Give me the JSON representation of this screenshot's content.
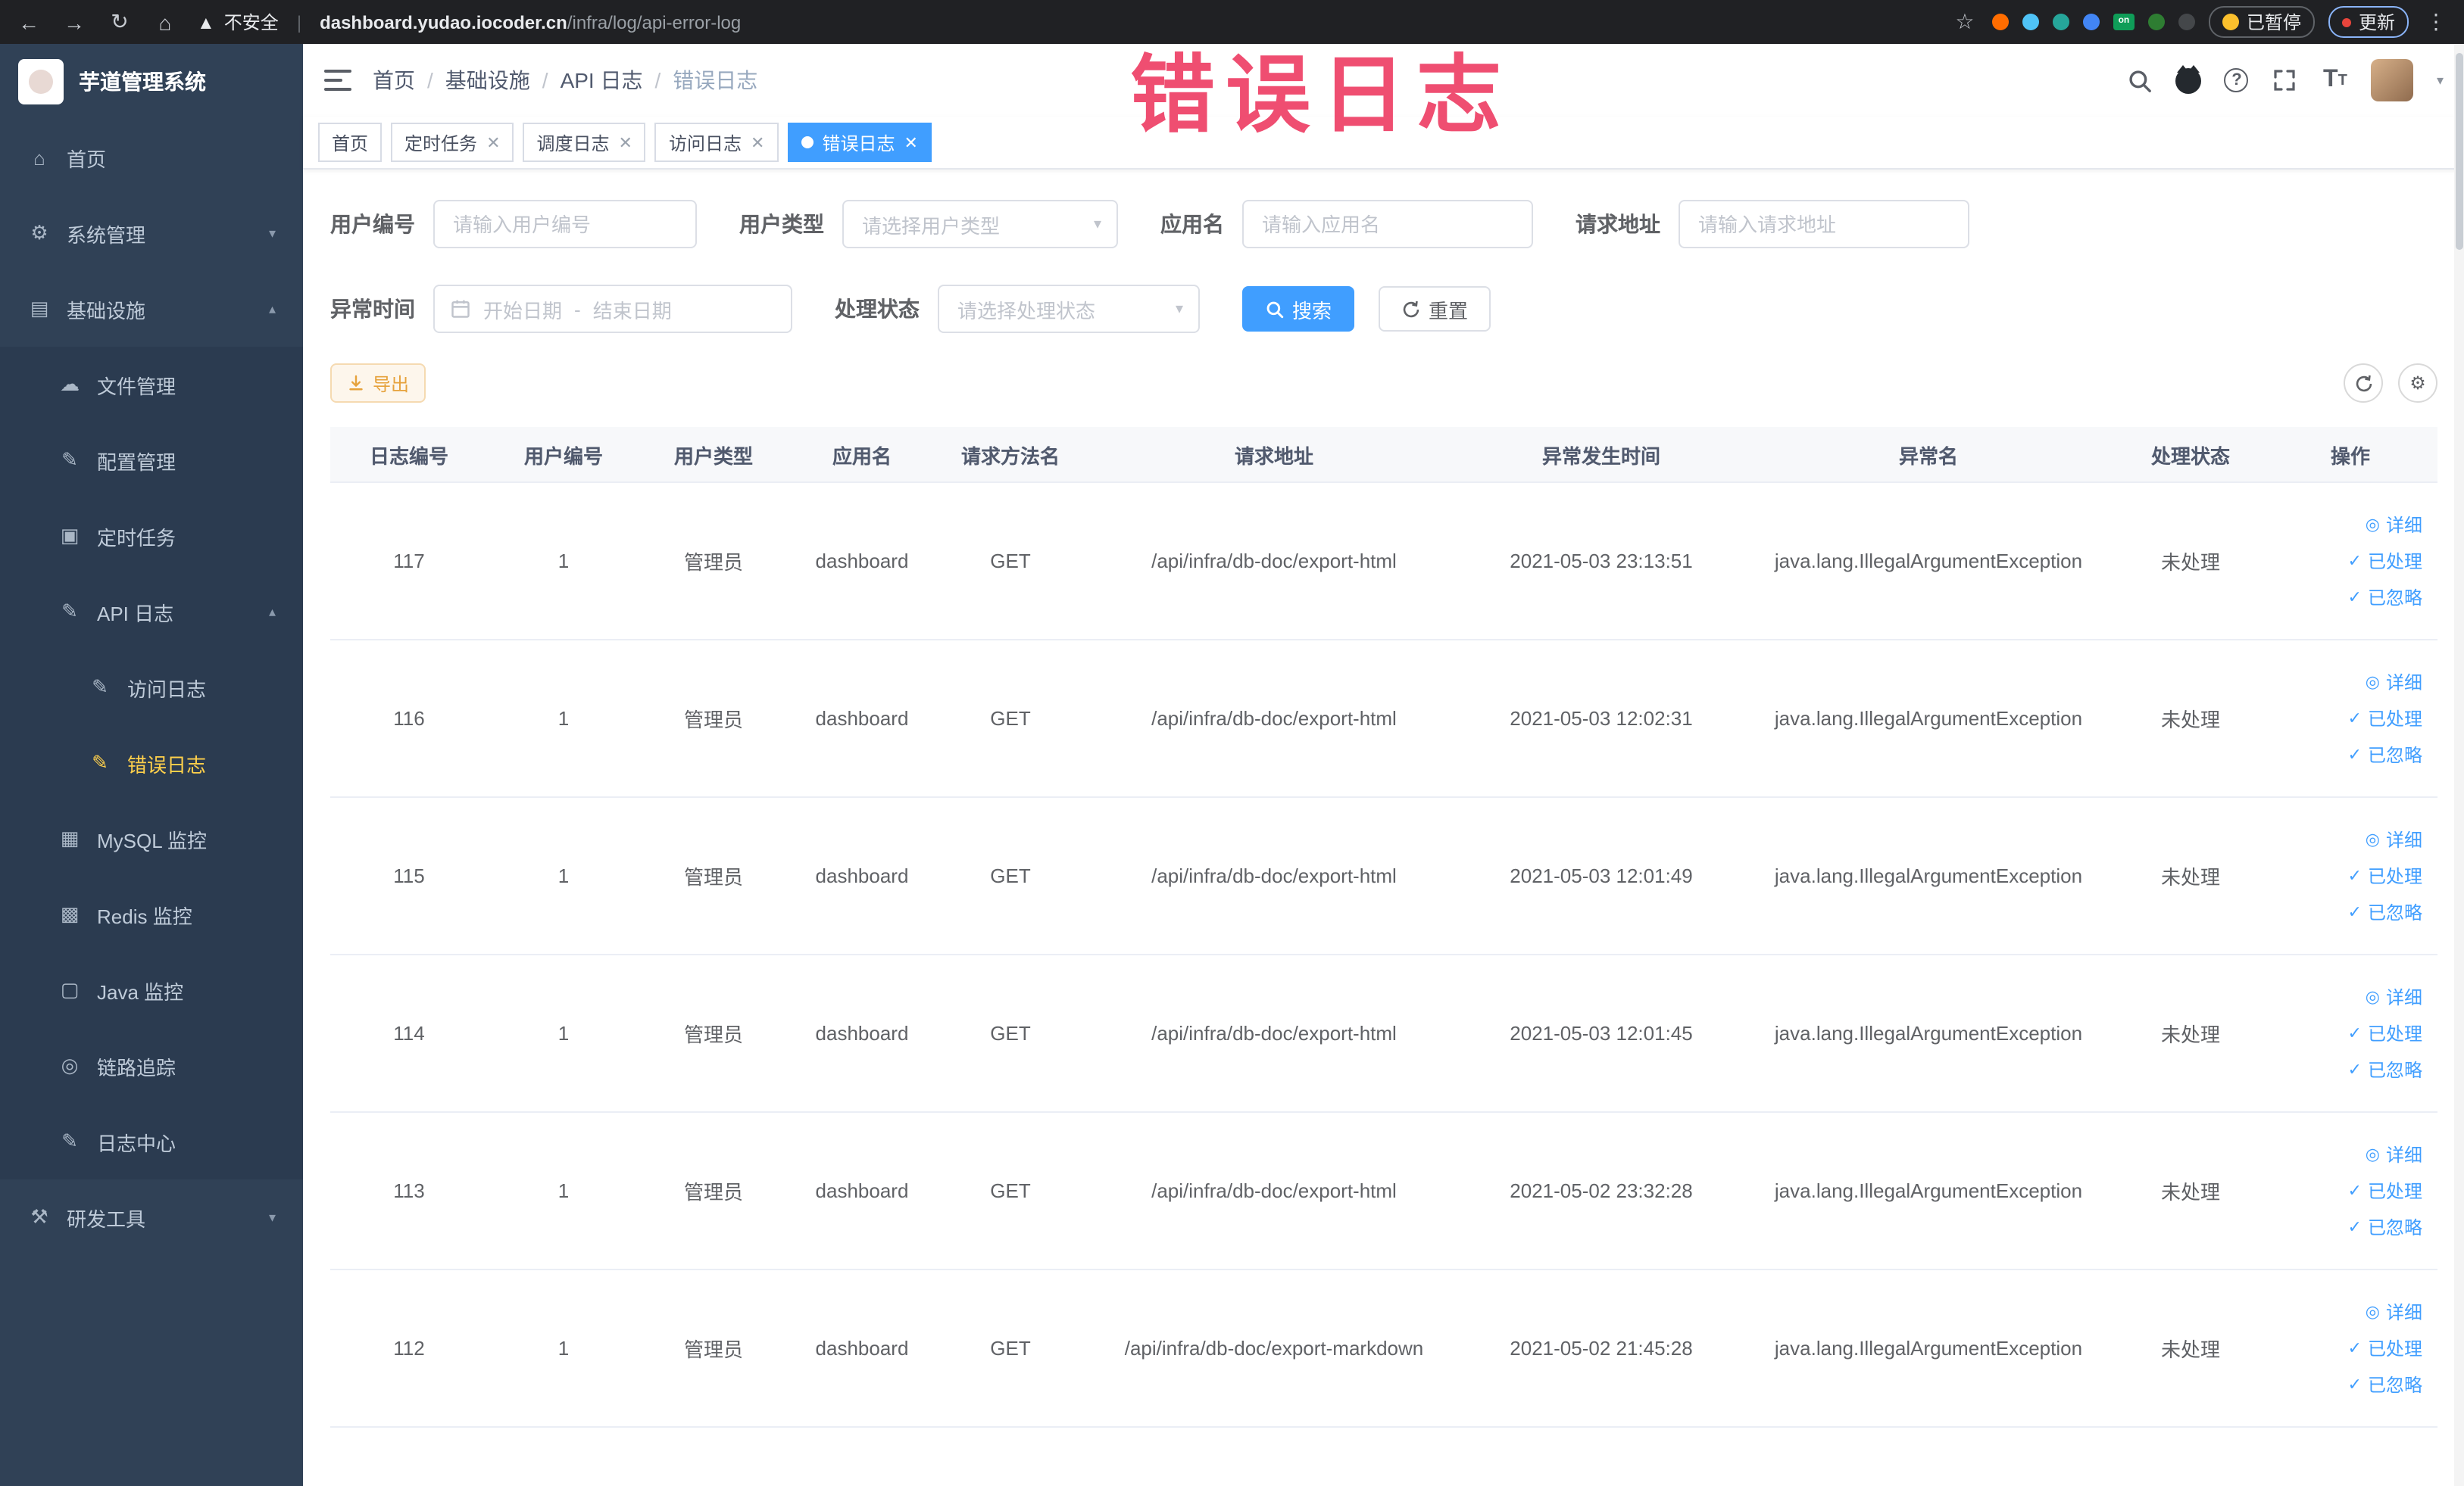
{
  "browser": {
    "security_label": "不安全",
    "url_host": "dashboard.yudao.iocoder.cn",
    "url_path": "/infra/log/api-error-log",
    "paused_badge": "已暂停",
    "update_label": "更新"
  },
  "overlay": {
    "title": "错误日志"
  },
  "sidebar": {
    "logo_title": "芋道管理系统",
    "items": [
      {
        "label": "首页"
      },
      {
        "label": "系统管理"
      },
      {
        "label": "基础设施"
      },
      {
        "label": "文件管理"
      },
      {
        "label": "配置管理"
      },
      {
        "label": "定时任务"
      },
      {
        "label": "API 日志"
      },
      {
        "label": "访问日志"
      },
      {
        "label": "错误日志"
      },
      {
        "label": "MySQL 监控"
      },
      {
        "label": "Redis 监控"
      },
      {
        "label": "Java 监控"
      },
      {
        "label": "链路追踪"
      },
      {
        "label": "日志中心"
      },
      {
        "label": "研发工具"
      }
    ]
  },
  "header": {
    "breadcrumb": [
      "首页",
      "基础设施",
      "API 日志",
      "错误日志"
    ]
  },
  "tabs": [
    {
      "label": "首页"
    },
    {
      "label": "定时任务"
    },
    {
      "label": "调度日志"
    },
    {
      "label": "访问日志"
    },
    {
      "label": "错误日志"
    }
  ],
  "filters": {
    "user_id": {
      "label": "用户编号",
      "placeholder": "请输入用户编号",
      "value": ""
    },
    "user_type": {
      "label": "用户类型",
      "placeholder": "请选择用户类型",
      "value": ""
    },
    "app_name": {
      "label": "应用名",
      "placeholder": "请输入应用名",
      "value": ""
    },
    "request_url": {
      "label": "请求地址",
      "placeholder": "请输入请求地址",
      "value": ""
    },
    "exception_time": {
      "label": "异常时间",
      "start_placeholder": "开始日期",
      "separator": "-",
      "end_placeholder": "结束日期"
    },
    "process_status": {
      "label": "处理状态",
      "placeholder": "请选择处理状态",
      "value": ""
    },
    "search_label": "搜索",
    "reset_label": "重置"
  },
  "toolbar": {
    "export_label": "导出"
  },
  "table": {
    "columns": [
      "日志编号",
      "用户编号",
      "用户类型",
      "应用名",
      "请求方法名",
      "请求地址",
      "异常发生时间",
      "异常名",
      "处理状态",
      "操作"
    ],
    "row_actions": [
      "详细",
      "已处理",
      "已忽略"
    ],
    "rows": [
      {
        "id": "117",
        "user_id": "1",
        "user_type": "管理员",
        "app": "dashboard",
        "method": "GET",
        "url": "/api/infra/db-doc/export-html",
        "time": "2021-05-03 23:13:51",
        "exception": "java.lang.IllegalArgumentException",
        "status": "未处理"
      },
      {
        "id": "116",
        "user_id": "1",
        "user_type": "管理员",
        "app": "dashboard",
        "method": "GET",
        "url": "/api/infra/db-doc/export-html",
        "time": "2021-05-03 12:02:31",
        "exception": "java.lang.IllegalArgumentException",
        "status": "未处理"
      },
      {
        "id": "115",
        "user_id": "1",
        "user_type": "管理员",
        "app": "dashboard",
        "method": "GET",
        "url": "/api/infra/db-doc/export-html",
        "time": "2021-05-03 12:01:49",
        "exception": "java.lang.IllegalArgumentException",
        "status": "未处理"
      },
      {
        "id": "114",
        "user_id": "1",
        "user_type": "管理员",
        "app": "dashboard",
        "method": "GET",
        "url": "/api/infra/db-doc/export-html",
        "time": "2021-05-03 12:01:45",
        "exception": "java.lang.IllegalArgumentException",
        "status": "未处理"
      },
      {
        "id": "113",
        "user_id": "1",
        "user_type": "管理员",
        "app": "dashboard",
        "method": "GET",
        "url": "/api/infra/db-doc/export-html",
        "time": "2021-05-02 23:32:28",
        "exception": "java.lang.IllegalArgumentException",
        "status": "未处理"
      },
      {
        "id": "112",
        "user_id": "1",
        "user_type": "管理员",
        "app": "dashboard",
        "method": "GET",
        "url": "/api/infra/db-doc/export-markdown",
        "time": "2021-05-02 21:45:28",
        "exception": "java.lang.IllegalArgumentException",
        "status": "未处理"
      }
    ]
  }
}
